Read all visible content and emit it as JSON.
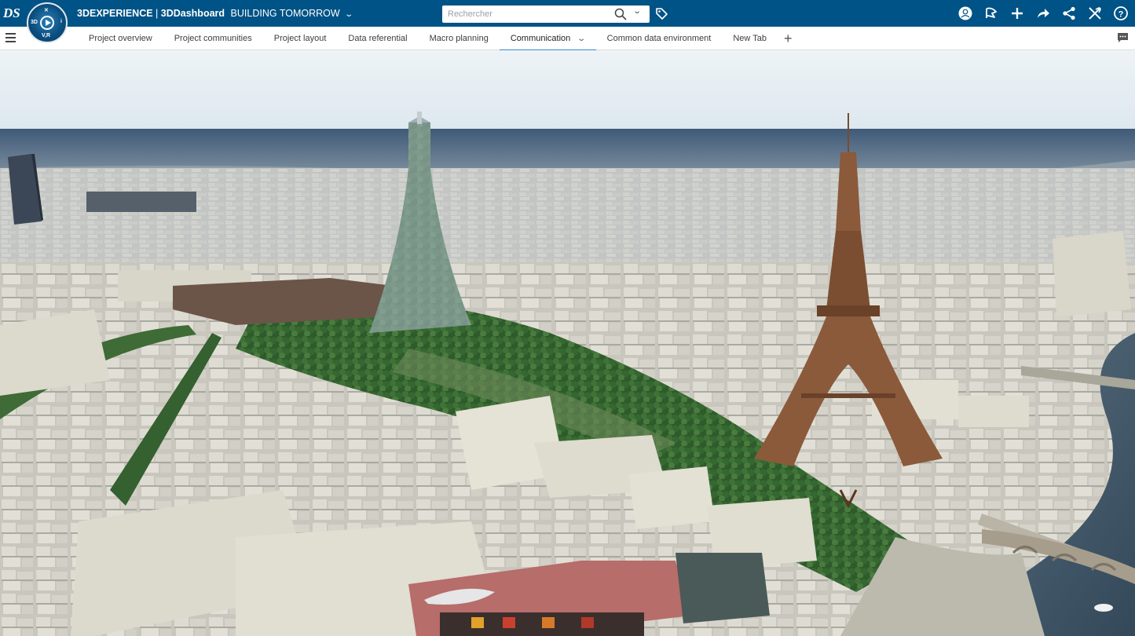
{
  "header": {
    "brand": "3DEXPERIENCE",
    "separator": " | ",
    "app": "3DDashboard",
    "dashboard": "BUILDING TOMORROW",
    "compass_version": "V,R",
    "compass_label": "3D"
  },
  "search": {
    "placeholder": "Rechercher"
  },
  "tabs": [
    {
      "label": "Project overview"
    },
    {
      "label": "Project communities"
    },
    {
      "label": "Project layout"
    },
    {
      "label": "Data referential"
    },
    {
      "label": "Macro planning"
    },
    {
      "label": "Communication"
    },
    {
      "label": "Common data environment"
    },
    {
      "label": "New Tab"
    }
  ],
  "icons": {
    "logo": "ds-logo-icon",
    "compass": "compass-icon",
    "search": "search-icon",
    "tag": "tag-icon",
    "profile": "user-profile-icon",
    "share_flag": "share-flag-icon",
    "add": "plus-icon",
    "forward": "share-arrow-icon",
    "network": "social-share-icon",
    "tools": "tools-icon",
    "help": "help-icon",
    "menu": "hamburger-menu-icon",
    "chat": "chat-icon"
  },
  "colors": {
    "topbar": "#005386",
    "active_tab": "#368ec4"
  }
}
